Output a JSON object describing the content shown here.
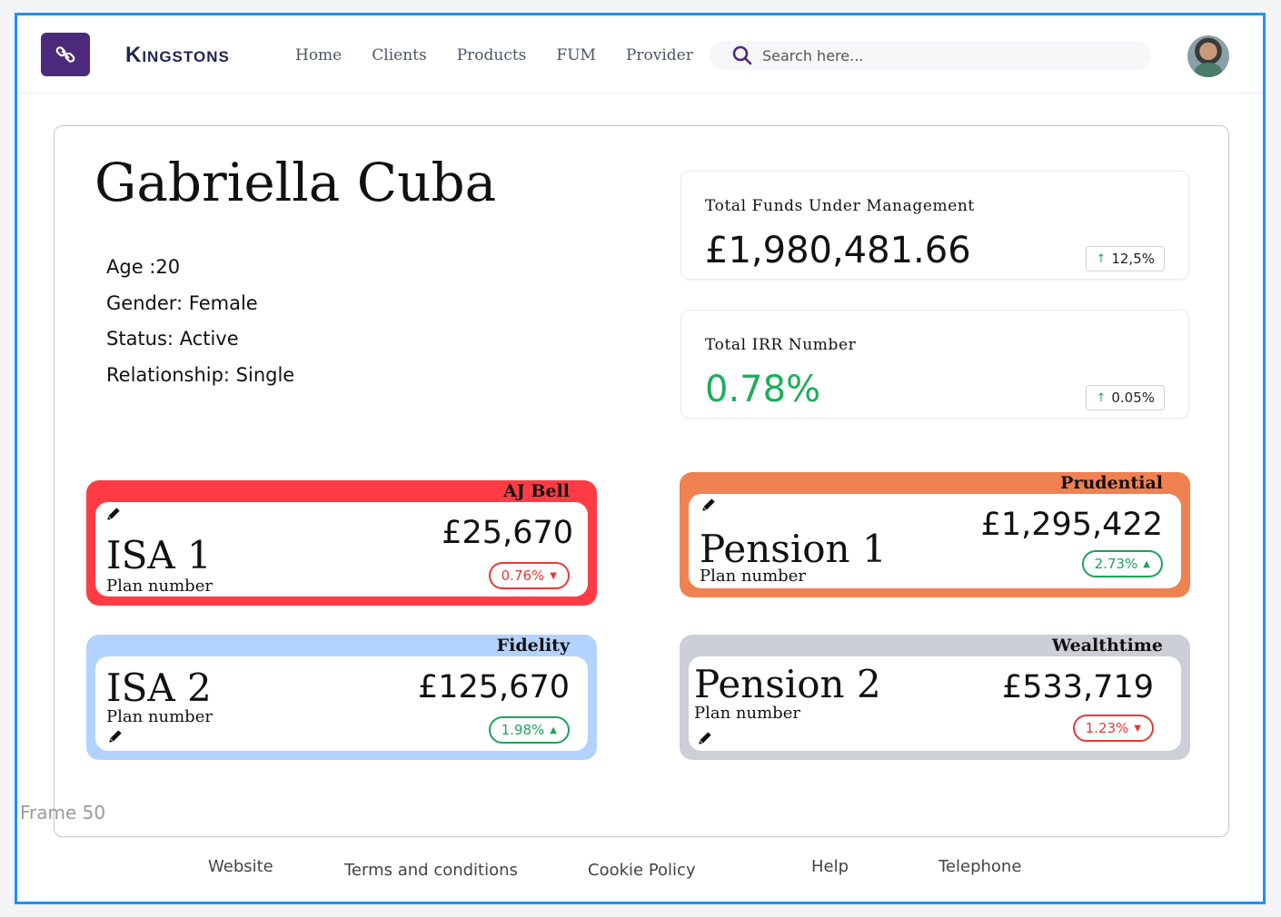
{
  "header": {
    "brand": "Kingstons",
    "nav": [
      "Home",
      "Clients",
      "Products",
      "FUM",
      "Provider"
    ],
    "search_placeholder": "Search here..."
  },
  "client": {
    "name": "Gabriella Cuba",
    "age": "Age :20",
    "gender": "Gender:  Female",
    "status": "Status: Active",
    "relationship": "Relationship:  Single"
  },
  "stats": {
    "fum": {
      "title": "Total Funds Under Management",
      "value": "£1,980,481.66",
      "change": "12,5%"
    },
    "irr": {
      "title": "Total IRR Number",
      "value": "0.78%",
      "change": "0.05%"
    }
  },
  "plans": {
    "isa1": {
      "provider": "AJ Bell",
      "name": "ISA 1",
      "sub": "Plan number",
      "amount": "£25,670",
      "change": "0.76%",
      "color": "#ff3c44"
    },
    "isa2": {
      "provider": "Fidelity",
      "name": "ISA 2",
      "sub": "Plan number",
      "amount": "£125,670",
      "change": "1.98%",
      "color": "#b3d3ff"
    },
    "pension1": {
      "provider": "Prudential",
      "name": "Pension 1",
      "sub": "Plan number",
      "amount": "£1,295,422",
      "change": "2.73%",
      "color": "#f08150"
    },
    "pension2": {
      "provider": "Wealthtime",
      "name": "Pension 2",
      "sub": "Plan number",
      "amount": "£533,719",
      "change": "1.23%",
      "color": "#ccd0d6"
    }
  },
  "footer": [
    "Website",
    "Terms and conditions",
    "Cookie Policy",
    "Help",
    "Telephone"
  ],
  "frame_label": "Frame 50",
  "colors": {
    "accent": "#1e90ff",
    "logo": "#4b2a7b",
    "positive": "#1fae5b",
    "negative": "#e53935"
  }
}
